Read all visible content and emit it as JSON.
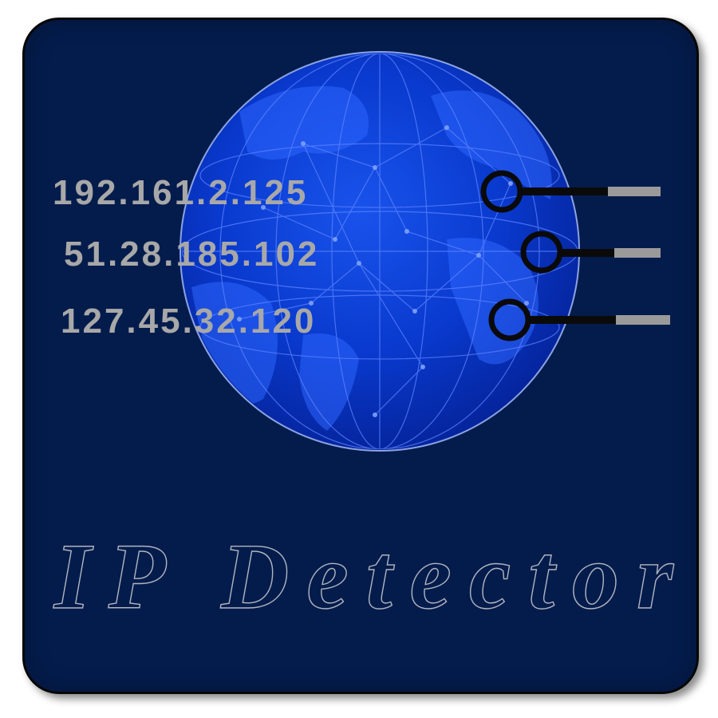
{
  "ip_addresses": [
    "192.161.2.125",
    "51.28.185.102",
    "127.45.32.120"
  ],
  "title": "IP Detector",
  "colors": {
    "background": "#041c4c",
    "globe": "#0a3fd6",
    "ip_grey": "#a8a8a8",
    "ip_dark": "#111111",
    "title_outline": "#b0b4c0"
  },
  "icons": [
    "globe-icon",
    "connector-icon"
  ]
}
